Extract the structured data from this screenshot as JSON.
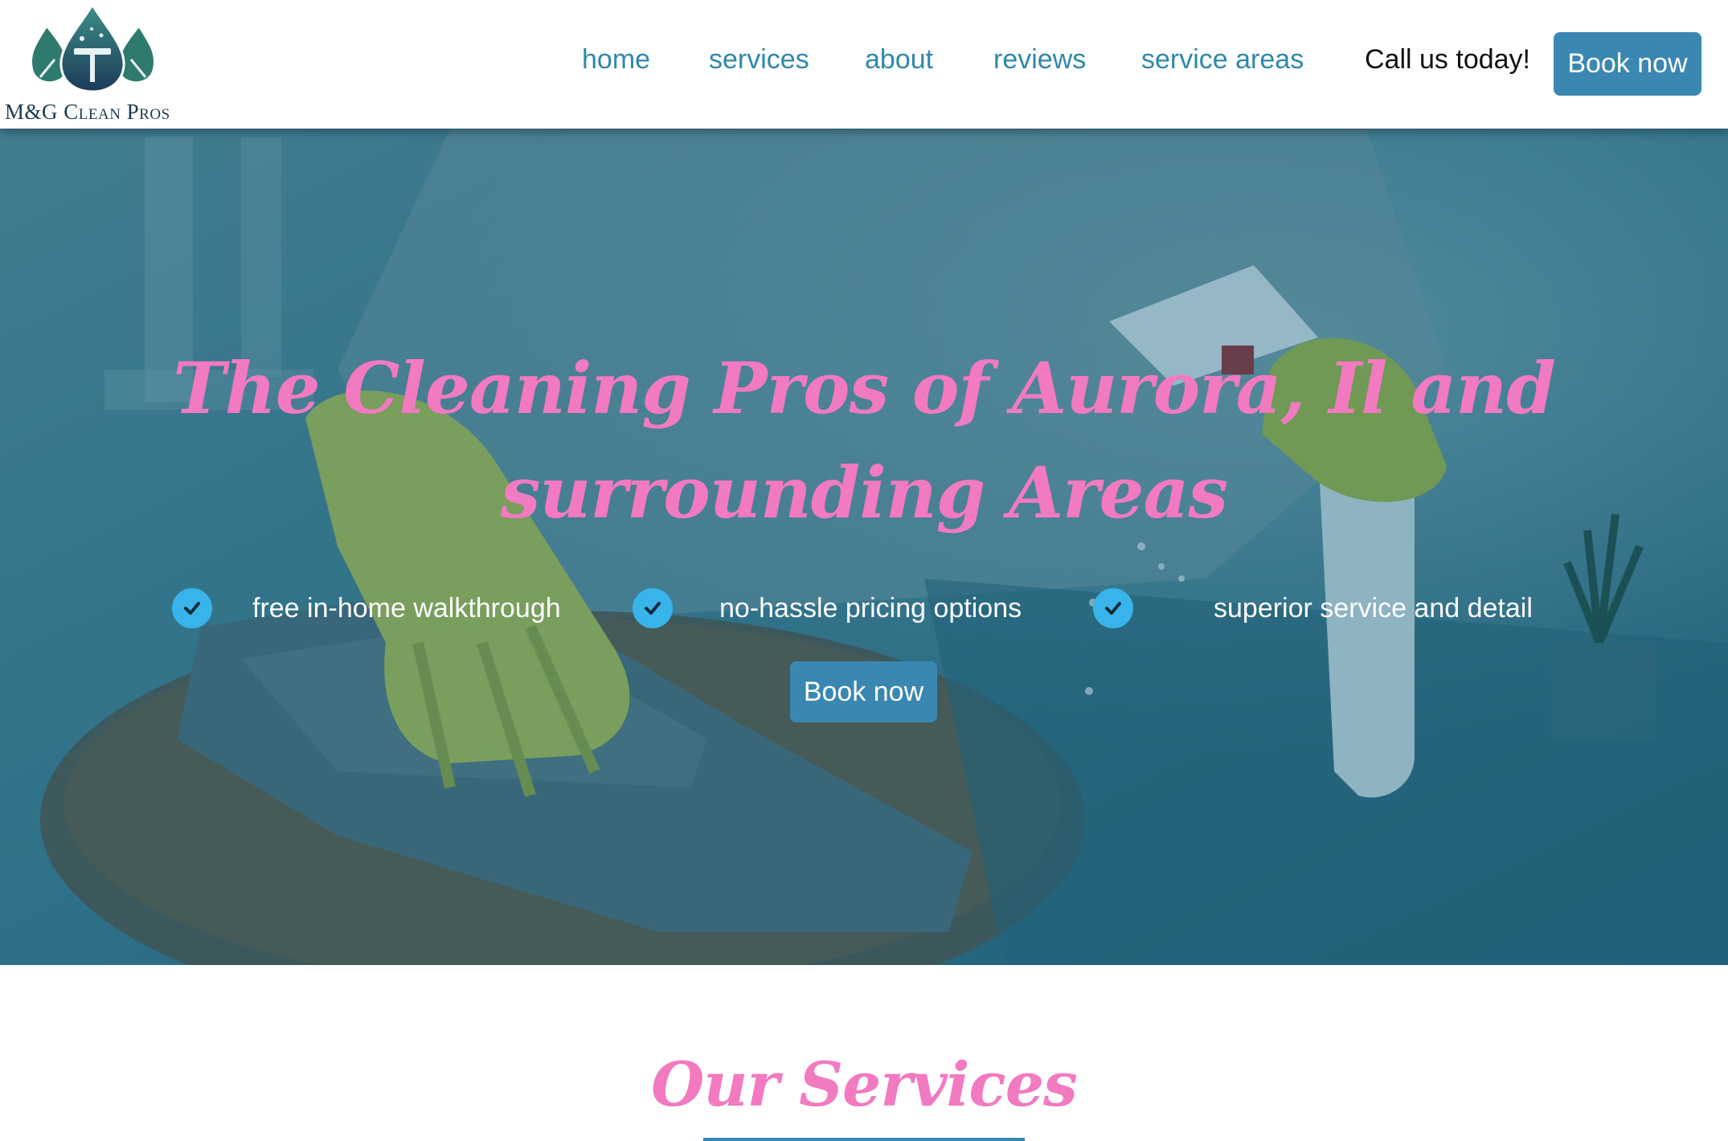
{
  "brand": {
    "name": "M&G Clean Pros",
    "colors": {
      "accent": "#3a87b1",
      "pink": "#f27ac0",
      "check": "#38b4ea",
      "navy": "#1d3b4f"
    }
  },
  "nav": {
    "items": [
      {
        "label": "home"
      },
      {
        "label": "services"
      },
      {
        "label": "about"
      },
      {
        "label": "reviews"
      },
      {
        "label": "service areas"
      }
    ],
    "call_text": "Call us today!",
    "book_label": "Book now"
  },
  "hero": {
    "title": "The Cleaning Pros of Aurora, Il and surrounding Areas",
    "features": [
      {
        "icon": "check-circle-icon",
        "text": "free in-home walkthrough"
      },
      {
        "icon": "check-circle-icon",
        "text": "no-hassle pricing options"
      },
      {
        "icon": "check-circle-icon",
        "text": "superior service and detail"
      }
    ],
    "book_label": "Book now"
  },
  "services": {
    "title": "Our Services"
  }
}
